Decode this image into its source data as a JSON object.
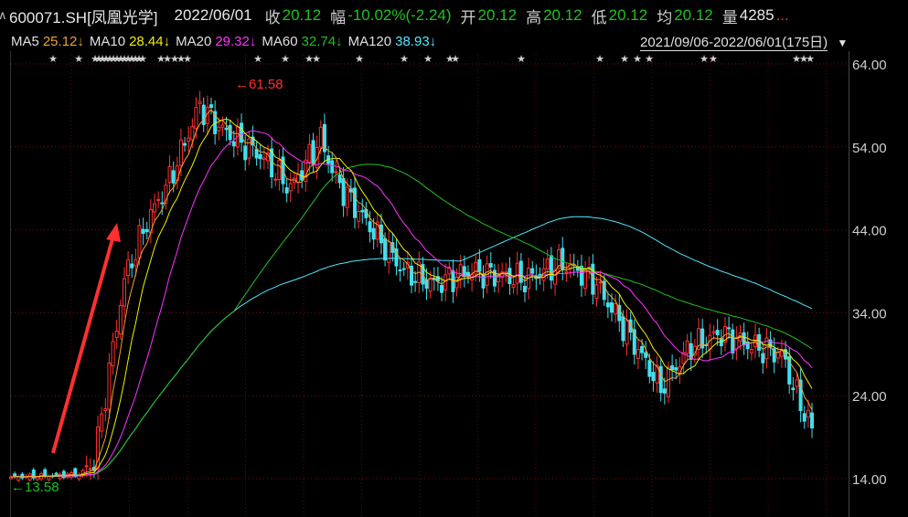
{
  "header": {
    "code": "600071.SH[凤凰光学]",
    "date": "2022/06/01",
    "close_label": "收",
    "close": "20.12",
    "change_label": "幅",
    "change": "-10.02%(-2.24)",
    "open_label": "开",
    "open": "20.12",
    "high_label": "高",
    "high": "20.12",
    "low_label": "低",
    "low": "20.12",
    "avg_label": "均",
    "avg": "20.12",
    "vol_label": "量",
    "vol": "4285",
    "more": "..."
  },
  "ma_bar": {
    "items": [
      {
        "label": "MA5",
        "value": "25.12",
        "arrow": "↓",
        "color": "#f0a030"
      },
      {
        "label": "MA10",
        "value": "28.44",
        "arrow": "↓",
        "color": "#f0f000"
      },
      {
        "label": "MA20",
        "value": "29.32",
        "arrow": "↓",
        "color": "#ff30ff"
      },
      {
        "label": "MA60",
        "value": "32.74",
        "arrow": "↓",
        "color": "#20c020"
      },
      {
        "label": "MA120",
        "value": "38.93",
        "arrow": "↓",
        "color": "#50e8ff"
      }
    ],
    "range": "2021/09/06-2022/06/01(175日)"
  },
  "chart_data": {
    "type": "candlestick",
    "ylim": [
      14,
      64
    ],
    "yticks": [
      "64.00",
      "54.00",
      "44.00",
      "34.00",
      "24.00",
      "14.00"
    ],
    "grid": true,
    "annotations": {
      "high_label": "61.58",
      "low_label": "13.58"
    },
    "anchors": [
      [
        0,
        14.2
      ],
      [
        18,
        14.5
      ],
      [
        22,
        16
      ],
      [
        30,
        38
      ],
      [
        36,
        45
      ],
      [
        42,
        50
      ],
      [
        50,
        59
      ],
      [
        56,
        56
      ],
      [
        66,
        53
      ],
      [
        74,
        49
      ],
      [
        82,
        55
      ],
      [
        86,
        50
      ],
      [
        94,
        45
      ],
      [
        104,
        39
      ],
      [
        112,
        37.5
      ],
      [
        122,
        39
      ],
      [
        136,
        38
      ],
      [
        146,
        40
      ],
      [
        154,
        38
      ],
      [
        164,
        31
      ],
      [
        172,
        25
      ],
      [
        180,
        30
      ],
      [
        188,
        31.5
      ],
      [
        196,
        30
      ],
      [
        204,
        29
      ],
      [
        208,
        24
      ],
      [
        212,
        20.1
      ]
    ],
    "colors": {
      "up": "#ff3030",
      "down": "#40e0ee",
      "ma5": "#f0a030",
      "ma10": "#f0f000",
      "ma20": "#ff30ff",
      "ma60": "#20c020",
      "ma120": "#50e8ff"
    }
  }
}
